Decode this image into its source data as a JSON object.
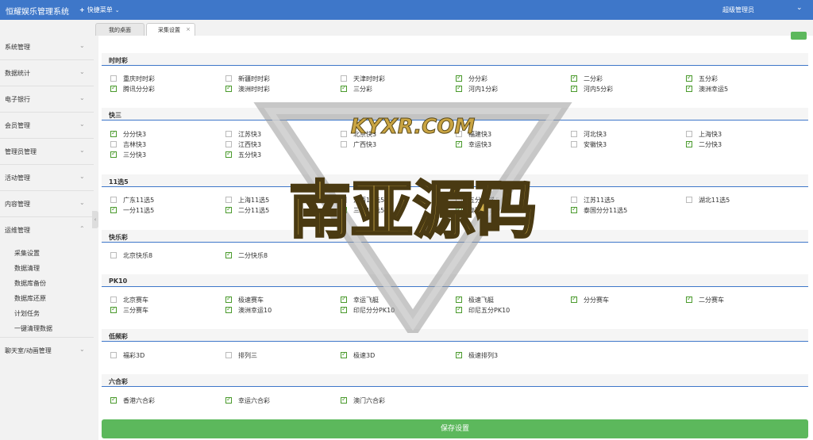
{
  "header": {
    "app_title": "恒耀娱乐管理系统",
    "quick_menu": "快捷菜单",
    "user": "超级管理员"
  },
  "sidebar": {
    "items": [
      {
        "label": "系统管理"
      },
      {
        "label": "数据统计"
      },
      {
        "label": "电子银行"
      },
      {
        "label": "会员管理"
      },
      {
        "label": "管理员管理"
      },
      {
        "label": "活动管理"
      },
      {
        "label": "内容管理"
      },
      {
        "label": "运维管理"
      }
    ],
    "subitems": [
      "采集设置",
      "数据清理",
      "数据库备份",
      "数据库还原",
      "计划任务",
      "一键清理数据"
    ],
    "last_item": "聊天室/动画管理"
  },
  "tabs": [
    {
      "label": "我的桌面"
    },
    {
      "label": "采集设置"
    }
  ],
  "sections": [
    {
      "title": "时时彩"
    },
    {
      "title": "快三"
    },
    {
      "title": "11选5"
    },
    {
      "title": "快乐彩"
    },
    {
      "title": "PK10"
    },
    {
      "title": "低频彩"
    },
    {
      "title": "六合彩"
    }
  ],
  "options": {
    "ssc": [
      {
        "label": "重庆时时彩",
        "checked": false
      },
      {
        "label": "新疆时时彩",
        "checked": false
      },
      {
        "label": "天津时时彩",
        "checked": false
      },
      {
        "label": "分分彩",
        "checked": true
      },
      {
        "label": "二分彩",
        "checked": true
      },
      {
        "label": "五分彩",
        "checked": true
      },
      {
        "label": "腾讯分分彩",
        "checked": true
      },
      {
        "label": "澳洲时时彩",
        "checked": true
      },
      {
        "label": "三分彩",
        "checked": true
      },
      {
        "label": "河内1分彩",
        "checked": true
      },
      {
        "label": "河内5分彩",
        "checked": true
      },
      {
        "label": "澳洲幸运5",
        "checked": true
      }
    ],
    "k3": [
      {
        "label": "分分快3",
        "checked": true
      },
      {
        "label": "江苏快3",
        "checked": false
      },
      {
        "label": "北京快3",
        "checked": false
      },
      {
        "label": "福建快3",
        "checked": false
      },
      {
        "label": "河北快3",
        "checked": false
      },
      {
        "label": "上海快3",
        "checked": false
      },
      {
        "label": "吉林快3",
        "checked": false
      },
      {
        "label": "江西快3",
        "checked": false
      },
      {
        "label": "广西快3",
        "checked": false
      },
      {
        "label": "幸运快3",
        "checked": true
      },
      {
        "label": "安徽快3",
        "checked": false
      },
      {
        "label": "二分快3",
        "checked": true
      },
      {
        "label": "三分快3",
        "checked": true
      },
      {
        "label": "五分快3",
        "checked": true
      }
    ],
    "x115": [
      {
        "label": "广东11选5",
        "checked": false
      },
      {
        "label": "上海11选5",
        "checked": false
      },
      {
        "label": "江西11选5",
        "checked": false
      },
      {
        "label": "五分11选5",
        "checked": false
      },
      {
        "label": "江苏11选5",
        "checked": false
      },
      {
        "label": "湖北11选5",
        "checked": false
      },
      {
        "label": "一分11选5",
        "checked": true
      },
      {
        "label": "二分11选5",
        "checked": true
      },
      {
        "label": "三分11选5",
        "checked": true
      },
      {
        "label": "泰国11选5",
        "checked": true
      },
      {
        "label": "泰国分分11选5",
        "checked": true
      }
    ],
    "kl8": [
      {
        "label": "北京快乐8",
        "checked": false
      },
      {
        "label": "二分快乐8",
        "checked": true
      }
    ],
    "pk10": [
      {
        "label": "北京赛车",
        "checked": false
      },
      {
        "label": "极速赛车",
        "checked": true
      },
      {
        "label": "幸运飞艇",
        "checked": true
      },
      {
        "label": "极速飞艇",
        "checked": true
      },
      {
        "label": "分分赛车",
        "checked": true
      },
      {
        "label": "二分赛车",
        "checked": true
      },
      {
        "label": "三分赛车",
        "checked": true
      },
      {
        "label": "澳洲幸运10",
        "checked": true
      },
      {
        "label": "印尼分分PK10",
        "checked": true
      },
      {
        "label": "印尼五分PK10",
        "checked": true
      }
    ],
    "dpc": [
      {
        "label": "福彩3D",
        "checked": false
      },
      {
        "label": "排列三",
        "checked": false
      },
      {
        "label": "极速3D",
        "checked": true
      },
      {
        "label": "极速排列3",
        "checked": true
      }
    ],
    "lhc": [
      {
        "label": "香港六合彩",
        "checked": true
      },
      {
        "label": "幸运六合彩",
        "checked": true
      },
      {
        "label": "澳门六合彩",
        "checked": true
      }
    ]
  },
  "save_button": "保存设置",
  "watermark": {
    "line1": "KYXR.COM",
    "line2": "南亚源码"
  },
  "colors": {
    "header_bg": "#3e77c9",
    "save_bg": "#5cb85c",
    "check": "#4a9a2c"
  }
}
